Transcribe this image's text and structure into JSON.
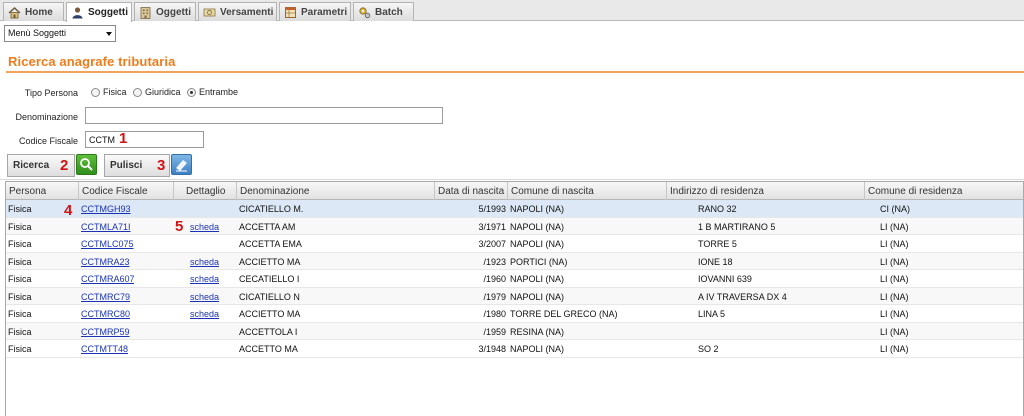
{
  "tabs": [
    {
      "label": "Home",
      "icon": "home-icon",
      "active": false
    },
    {
      "label": "Soggetti",
      "icon": "person-icon",
      "active": true
    },
    {
      "label": "Oggetti",
      "icon": "building-icon",
      "active": false
    },
    {
      "label": "Versamenti",
      "icon": "coins-icon",
      "active": false
    },
    {
      "label": "Parametri",
      "icon": "table-icon",
      "active": false
    },
    {
      "label": "Batch",
      "icon": "gear-icon",
      "active": false
    }
  ],
  "menu": {
    "selected": "Menù Soggetti"
  },
  "page": {
    "title": "Ricerca anagrafe tributaria"
  },
  "form": {
    "tipo_persona_label": "Tipo Persona",
    "options": [
      "Fisica",
      "Giuridica",
      "Entrambe"
    ],
    "selected_option": "Entrambe",
    "denominazione_label": "Denominazione",
    "denominazione_value": "",
    "codice_fiscale_label": "Codice Fiscale",
    "codice_fiscale_value": "CCTM"
  },
  "buttons": {
    "search": "Ricerca",
    "clear": "Pulisci"
  },
  "annotations": [
    "1",
    "2",
    "3",
    "4",
    "5"
  ],
  "grid": {
    "columns": [
      "Persona",
      "Codice Fiscale",
      "Dettaglio",
      "Denominazione",
      "Data di nascita",
      "Comune di nascita",
      "Indirizzo di residenza",
      "Comune di residenza"
    ],
    "rows": [
      {
        "persona": "Fisica",
        "cf": "CCTMGH93",
        "dettaglio": "",
        "den": "CICATIELLO M.",
        "data": "5/1993",
        "comune": "NAPOLI (NA)",
        "indirizzo": "RANO 32",
        "residenza": "CI (NA)",
        "selected": true
      },
      {
        "persona": "Fisica",
        "cf": "CCTMLA71I",
        "dettaglio": "scheda",
        "den": "ACCETTA AM",
        "data": "3/1971",
        "comune": "NAPOLI (NA)",
        "indirizzo": "1 B MARTIRANO 5",
        "residenza": "LI (NA)",
        "selected": false
      },
      {
        "persona": "Fisica",
        "cf": "CCTMLC075",
        "dettaglio": "",
        "den": "ACCETTA EMA",
        "data": "3/2007",
        "comune": "NAPOLI (NA)",
        "indirizzo": "TORRE 5",
        "residenza": "LI (NA)",
        "selected": false
      },
      {
        "persona": "Fisica",
        "cf": "CCTMRA23",
        "dettaglio": "scheda",
        "den": "ACCIETTO MA",
        "data": "/1923",
        "comune": "PORTICI (NA)",
        "indirizzo": "IONE 18",
        "residenza": "LI (NA)",
        "selected": false
      },
      {
        "persona": "Fisica",
        "cf": "CCTMRA607",
        "dettaglio": "scheda",
        "den": "CECATIELLO I",
        "data": "/1960",
        "comune": "NAPOLI (NA)",
        "indirizzo": "IOVANNI 639",
        "residenza": "LI (NA)",
        "selected": false
      },
      {
        "persona": "Fisica",
        "cf": "CCTMRC79",
        "dettaglio": "scheda",
        "den": "CICATIELLO N",
        "data": "/1979",
        "comune": "NAPOLI (NA)",
        "indirizzo": "A IV TRAVERSA DX 4",
        "residenza": "LI (NA)",
        "selected": false
      },
      {
        "persona": "Fisica",
        "cf": "CCTMRC80",
        "dettaglio": "scheda",
        "den": "ACCIETTO MA",
        "data": "/1980",
        "comune": "TORRE DEL GRECO (NA)",
        "indirizzo": "LINA 5",
        "residenza": "LI (NA)",
        "selected": false
      },
      {
        "persona": "Fisica",
        "cf": "CCTMRP59",
        "dettaglio": "",
        "den": "ACCETTOLA I",
        "data": "/1959",
        "comune": "RESINA (NA)",
        "indirizzo": "",
        "residenza": "LI (NA)",
        "selected": false
      },
      {
        "persona": "Fisica",
        "cf": "CCTMTT48",
        "dettaglio": "",
        "den": "ACCETTO MA",
        "data": "3/1948",
        "comune": "NAPOLI (NA)",
        "indirizzo": "SO 2",
        "residenza": "LI (NA)",
        "selected": false
      }
    ]
  },
  "colors": {
    "accent": "#f07b1a",
    "link": "#1a33b5",
    "annotation": "#d01313",
    "selected_row": "#dce8f5"
  }
}
